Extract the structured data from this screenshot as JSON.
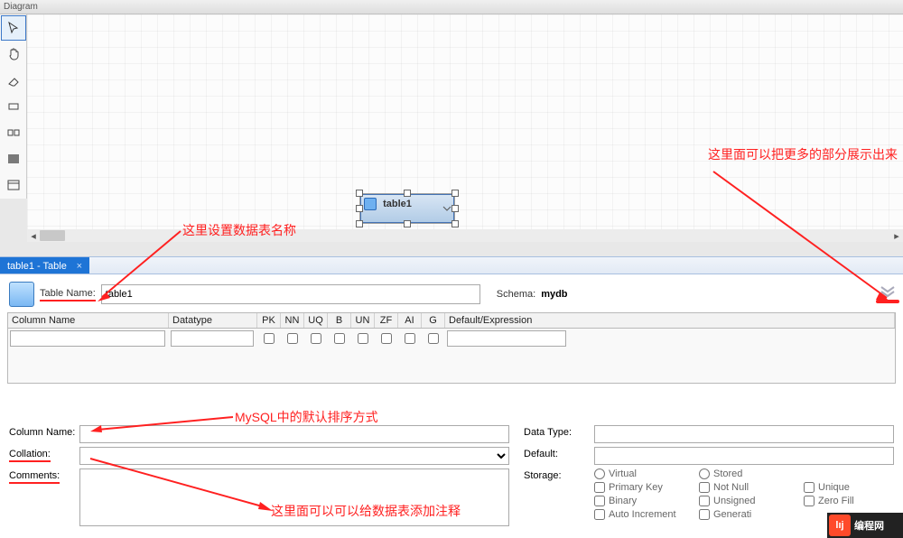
{
  "header": {
    "label": "Diagram"
  },
  "toolbar": {
    "items": [
      {
        "name": "arrow-icon",
        "sel": true
      },
      {
        "name": "hand-icon",
        "sel": false
      },
      {
        "name": "eraser-icon",
        "sel": false
      },
      {
        "name": "layer-icon",
        "sel": false
      },
      {
        "name": "nn-icon",
        "sel": false
      },
      {
        "name": "image-icon",
        "sel": false
      },
      {
        "name": "text-icon",
        "sel": false
      }
    ]
  },
  "canvas_table": {
    "name": "table1"
  },
  "tab": {
    "label": "table1 - Table"
  },
  "table_editor": {
    "name_label": "Table Name:",
    "name_value": "table1",
    "schema_label": "Schema:",
    "schema_value": "mydb"
  },
  "columns_grid": {
    "headers": {
      "cn": "Column Name",
      "dt": "Datatype",
      "pk": "PK",
      "nn": "NN",
      "uq": "UQ",
      "b": "B",
      "un": "UN",
      "zf": "ZF",
      "ai": "AI",
      "g": "G",
      "de": "Default/Expression"
    },
    "row": {
      "cn": "",
      "dt": "",
      "de": ""
    }
  },
  "column_detail": {
    "left": {
      "column_name_label": "Column Name:",
      "column_name_value": "",
      "collation_label": "Collation:",
      "collation_value": "",
      "comments_label": "Comments:",
      "comments_value": ""
    },
    "right": {
      "data_type_label": "Data Type:",
      "data_type_value": "",
      "default_label": "Default:",
      "default_value": "",
      "storage_label": "Storage:",
      "virtual": "Virtual",
      "stored": "Stored",
      "primary_key": "Primary Key",
      "not_null": "Not Null",
      "unique": "Unique",
      "binary": "Binary",
      "unsigned": "Unsigned",
      "zero_fill": "Zero Fill",
      "auto_increment": "Auto Increment",
      "generated": "Generati"
    }
  },
  "annotations": {
    "a1": "这里设置数据表名称",
    "a2": "MySQL中的默认排序方式",
    "a3": "这里面可以可以给数据表添加注释",
    "a4": "这里面可以把更多的部分展示出来"
  },
  "logo_text": "编程网"
}
